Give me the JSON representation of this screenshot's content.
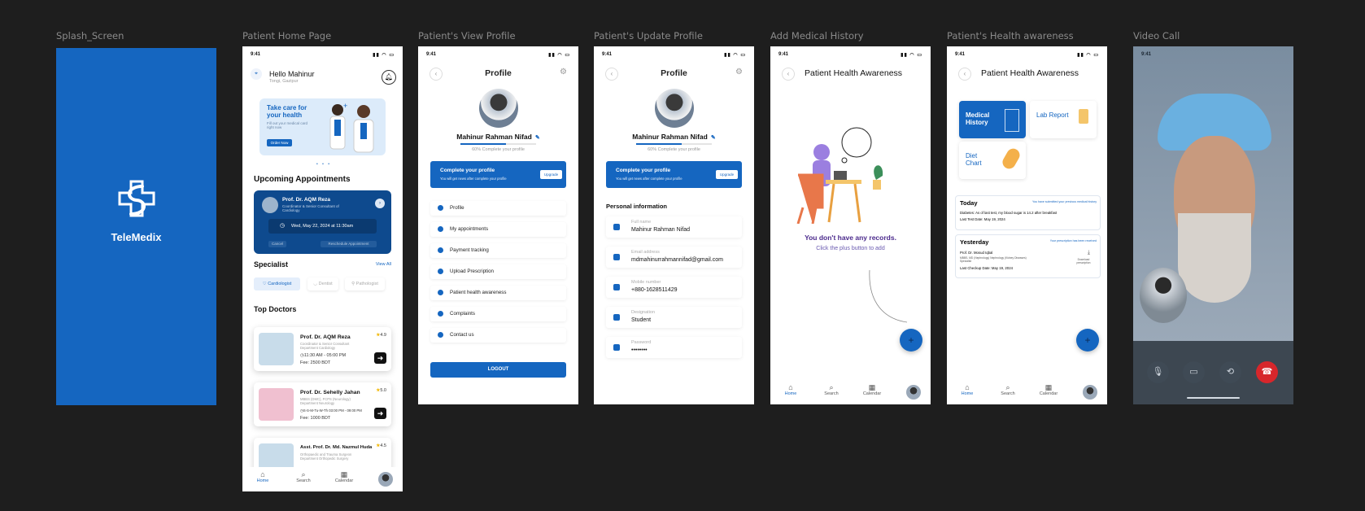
{
  "labels": {
    "splash": "Splash_Screen",
    "home": "Patient Home Page",
    "view": "Patient's View Profile",
    "update": "Patient's Update Profile",
    "addhist": "Add Medical History",
    "aware": "Patient's Health awareness",
    "video": "Video Call"
  },
  "status": {
    "time": "9:41"
  },
  "splash": {
    "app_name": "TeleMedix",
    "bg": "#1566c0"
  },
  "nav": {
    "home": "Home",
    "search": "Search",
    "calendar": "Calendar"
  },
  "home": {
    "greeting": "Hello Mahinur",
    "location": "Tongi, Gazipur",
    "promo_title": "Take care for your health",
    "promo_sub": "Fill out your medical card right now",
    "promo_btn": "Order Now",
    "upcoming_title": "Upcoming Appointments",
    "appt_doctor": "Prof. Dr. AQM Reza",
    "appt_role": "Coordinator & Senior Consultant of Cardiology",
    "appt_time": "Wed, May 22, 2024 at 11:30am",
    "appt_cancel": "Cancel",
    "appt_resched": "Reschedule Appointment",
    "specialist_title": "Specialist",
    "view_all": "View All",
    "specialists": [
      "Cardiologist",
      "Dentist",
      "Pathologist"
    ],
    "top_doctors": "Top Doctors",
    "doctors": [
      {
        "name": "Prof. Dr. AQM Reza",
        "desc": "Coordinator & Senior Consultant Department Cardiology",
        "time": "11:30 AM - 05:00 PM",
        "fee": "Fee: 2500 BDT",
        "rating": "4.9"
      },
      {
        "name": "Prof. Dr. Sehelly Jahan",
        "desc": "MBBS (DMC), FCPS (Neurology) Department Neurology",
        "time": "S-S-M-Tu-W-Th 03:00 PM - 09:00 PM",
        "fee": "Fee: 1000 BDT",
        "rating": "5.0"
      },
      {
        "name": "Asst. Prof. Dr. Md. Nazmul Huda",
        "desc": "Orthopaedic and Trauma Surgeon Department Orthopedic Surgery",
        "time": "",
        "fee": "",
        "rating": "4.5"
      }
    ]
  },
  "profile": {
    "title": "Profile",
    "name": "Mahinur Rahman Nifad",
    "progress": 0.6,
    "complete_text": "60% Complete your profile",
    "banner_title": "Complete your profile",
    "banner_sub": "You will get news after complete your profile",
    "banner_btn": "Upgrade",
    "menu": [
      "Profile",
      "My appointments",
      "Payment tracking",
      "Upload Prescription",
      "Patient health awareness",
      "Complaints",
      "Contact us"
    ],
    "logout": "LOGOUT"
  },
  "update": {
    "section": "Personal information",
    "fields": [
      {
        "label": "Full name",
        "value": "Mahinur Rahman Nifad"
      },
      {
        "label": "Email address",
        "value": "mdmahinurrahmannifad@gmail.com"
      },
      {
        "label": "Mobile number",
        "value": "+880-1628511429"
      },
      {
        "label": "Designation",
        "value": "Student"
      },
      {
        "label": "Password",
        "value": "••••••••"
      }
    ]
  },
  "history": {
    "title": "Patient Health Awareness",
    "empty_title": "You don't have any records.",
    "empty_sub": "Click the plus button to add",
    "fab": "+"
  },
  "awareness": {
    "title": "Patient Health Awareness",
    "tiles": [
      "Medical History",
      "Lab Report",
      "Diet Chart"
    ],
    "today_label": "Today",
    "today_link": "You have submitted your previous medical history",
    "today_text": "Diabetes: As of last test, my blood sugar is 14.2 after breakfast",
    "today_date": "Last Test Date: May 19, 2024",
    "yesterday_label": "Yesterday",
    "yesterday_link": "Your prescription has been received",
    "yesterday_doctor": "Prof. Dr. Mosud Iqbal",
    "yesterday_deg": "MBBS, MD (Nephrology) Nephrology (Kidney Diseases) Specialist",
    "yesterday_date": "Last Checkup Date: May 19, 2024",
    "download": "Download prescription"
  }
}
